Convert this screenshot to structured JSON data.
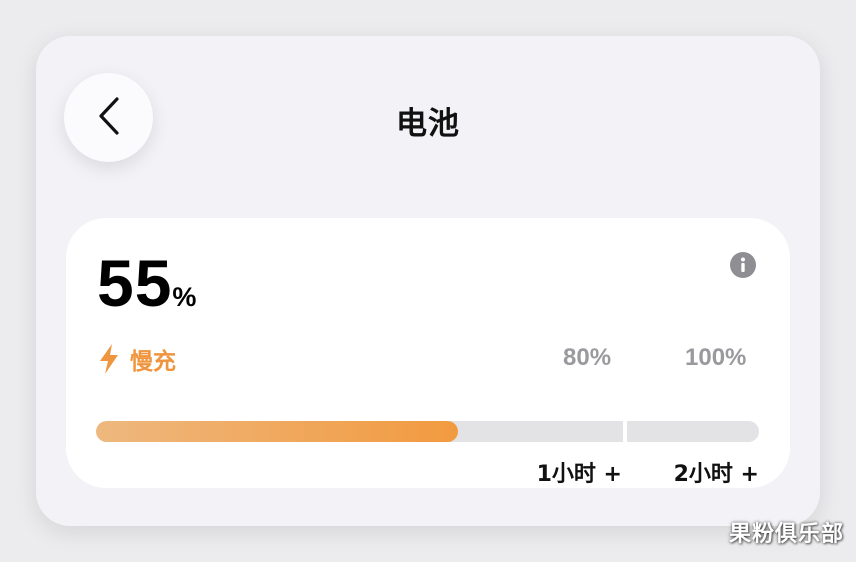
{
  "header": {
    "title": "电池",
    "back_icon": "chevron-left-icon"
  },
  "battery": {
    "level_value": "55",
    "level_unit": "%",
    "level_fraction": 0.55,
    "charge_mode": "慢充",
    "charge_icon": "bolt-icon",
    "info_icon": "info-icon",
    "markers": [
      "80%",
      "100%"
    ],
    "time_estimates": [
      "1小时 +",
      "2小时 +"
    ],
    "accent_color": "#f29a40"
  },
  "watermark": "果粉俱乐部"
}
